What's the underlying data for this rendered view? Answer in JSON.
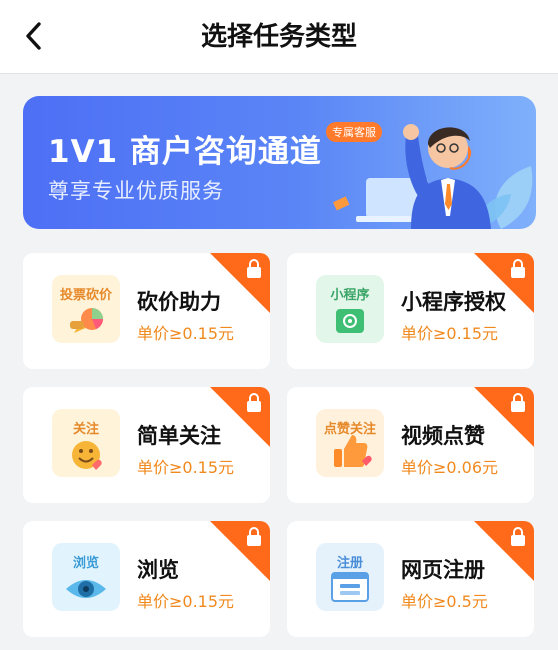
{
  "header": {
    "title": "选择任务类型"
  },
  "banner": {
    "title": "1V1 商户咨询通道",
    "subtitle": "尊享专业优质服务",
    "tag": "专属客服"
  },
  "tasks": [
    {
      "name": "砍价助力",
      "price": "单价≥0.15元",
      "icon_label": "投票砍价",
      "icon": "bargain-icon",
      "locked": true
    },
    {
      "name": "小程序授权",
      "price": "单价≥0.15元",
      "icon_label": "小程序",
      "icon": "miniprogram-icon",
      "locked": true
    },
    {
      "name": "简单关注",
      "price": "单价≥0.15元",
      "icon_label": "关注",
      "icon": "follow-smile-icon",
      "locked": true
    },
    {
      "name": "视频点赞",
      "price": "单价≥0.06元",
      "icon_label": "点赞关注",
      "icon": "thumbs-up-icon",
      "locked": true
    },
    {
      "name": "浏览",
      "price": "单价≥0.15元",
      "icon_label": "浏览",
      "icon": "eye-icon",
      "locked": true
    },
    {
      "name": "网页注册",
      "price": "单价≥0.5元",
      "icon_label": "注册",
      "icon": "web-register-icon",
      "locked": true
    }
  ],
  "colors": {
    "accent_orange": "#ff6a1a",
    "price_orange": "#f08a1f",
    "banner_blue": "#4d6ff5"
  }
}
